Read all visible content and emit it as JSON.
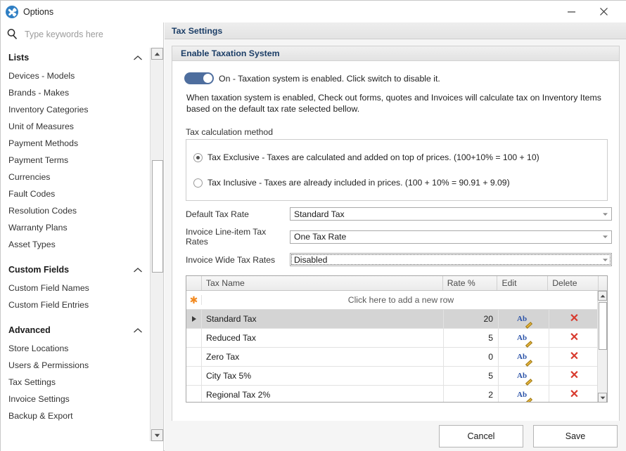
{
  "titlebar": {
    "title": "Options",
    "icon": "tools-icon",
    "minimize_label": "–",
    "close_label": "×"
  },
  "sidebar": {
    "search": {
      "placeholder": "Type keywords here",
      "value": "",
      "icon": "search-icon"
    },
    "groups": [
      {
        "label": "Lists",
        "collapse_icon": "chevron-up-icon",
        "items": [
          "Devices - Models",
          "Brands - Makes",
          "Inventory Categories",
          "Unit of Measures",
          "Payment Methods",
          "Payment Terms",
          "Currencies",
          "Fault Codes",
          "Resolution Codes",
          "Warranty Plans",
          "Asset Types"
        ]
      },
      {
        "label": "Custom Fields",
        "collapse_icon": "chevron-up-icon",
        "items": [
          "Custom Field Names",
          "Custom Field Entries"
        ]
      },
      {
        "label": "Advanced",
        "collapse_icon": "chevron-up-icon",
        "items": [
          "Store Locations",
          "Users & Permissions",
          "Tax Settings",
          "Invoice Settings",
          "Backup & Export"
        ]
      }
    ]
  },
  "main": {
    "panel_title": "Tax Settings",
    "group_title": "Enable Taxation System",
    "toggle": {
      "state": "on",
      "label": "On - Taxation system is enabled. Click switch to disable it.",
      "color": "#4e6e9e"
    },
    "description": "When taxation system is enabled, Check out forms, quotes and Invoices will calculate tax on Inventory Items based on the default tax rate selected bellow.",
    "calc_method": {
      "label": "Tax calculation method",
      "options": [
        {
          "label": "Tax Exclusive - Taxes are calculated and added on top of prices. (100+10% = 100 + 10)",
          "selected": true
        },
        {
          "label": "Tax Inclusive - Taxes are already included in prices. (100 + 10% = 90.91 + 9.09)",
          "selected": false
        }
      ]
    },
    "dropdowns": [
      {
        "label": "Default Tax Rate",
        "value": "Standard Tax",
        "focused": false
      },
      {
        "label": "Invoice Line-item Tax Rates",
        "value": "One Tax Rate",
        "focused": false
      },
      {
        "label": "Invoice Wide Tax Rates",
        "value": "Disabled",
        "focused": true
      }
    ],
    "grid": {
      "columns": [
        "Tax Name",
        "Rate %",
        "Edit",
        "Delete"
      ],
      "new_row_text": "Click here to add a new row",
      "new_row_icon": "asterisk-icon",
      "rows": [
        {
          "name": "Standard Tax",
          "rate": "20",
          "selected": true,
          "edit_icon": "rename-icon",
          "delete_icon": "delete-x-icon"
        },
        {
          "name": "Reduced Tax",
          "rate": "5",
          "selected": false,
          "edit_icon": "rename-icon",
          "delete_icon": "delete-x-icon"
        },
        {
          "name": "Zero Tax",
          "rate": "0",
          "selected": false,
          "edit_icon": "rename-icon",
          "delete_icon": "delete-x-icon"
        },
        {
          "name": "City Tax 5%",
          "rate": "5",
          "selected": false,
          "edit_icon": "rename-icon",
          "delete_icon": "delete-x-icon"
        },
        {
          "name": "Regional Tax 2%",
          "rate": "2",
          "selected": false,
          "edit_icon": "rename-icon",
          "delete_icon": "delete-x-icon"
        }
      ]
    },
    "footer": {
      "cancel_label": "Cancel",
      "save_label": "Save"
    }
  }
}
